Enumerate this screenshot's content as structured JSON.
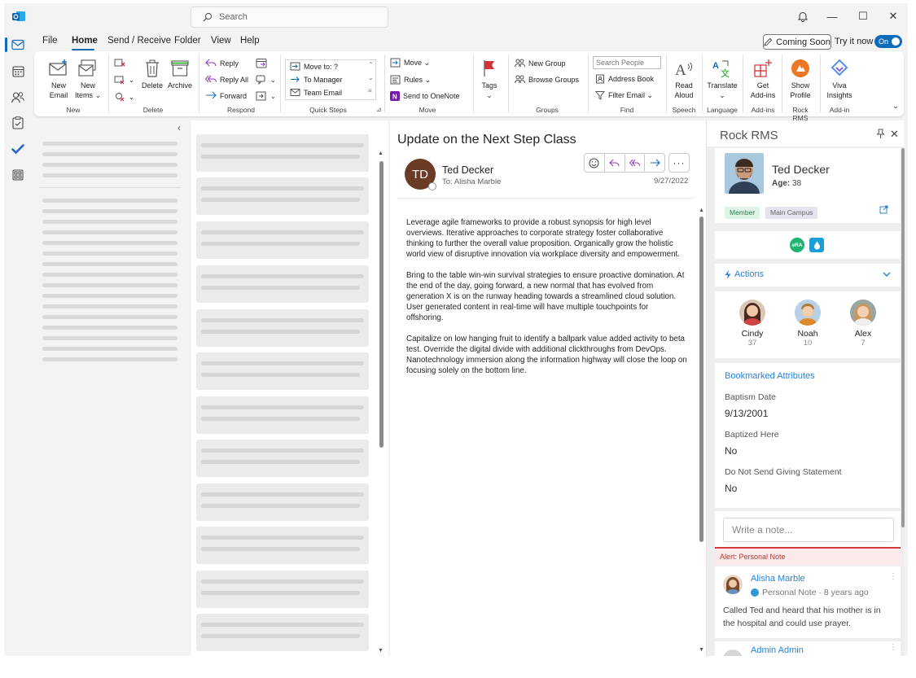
{
  "titlebar": {
    "search_placeholder": "Search",
    "minimize": "—",
    "maximize": "☐",
    "close": "✕"
  },
  "menu": {
    "items": [
      "File",
      "Home",
      "Send / Receive",
      "Folder",
      "View",
      "Help"
    ],
    "active": "Home",
    "coming_soon": "Coming Soon",
    "try_it_now": "Try it now",
    "toggle": "On"
  },
  "ribbon": {
    "new": {
      "new_email_1": "New",
      "new_email_2": "Email",
      "new_items_1": "New",
      "new_items_2": "Items ⌄",
      "label": "New"
    },
    "delete": {
      "delete": "Delete",
      "archive": "Archive",
      "label": "Delete"
    },
    "respond": {
      "reply": "Reply",
      "reply_all": "Reply All",
      "forward": "Forward",
      "label": "Respond"
    },
    "quick_steps": {
      "move_to": "Move to: ?",
      "to_manager": "To Manager",
      "team_email": "Team Email",
      "label": "Quick Steps"
    },
    "move": {
      "move": "Move ⌄",
      "rules": "Rules ⌄",
      "onenote": "Send to OneNote",
      "label": "Move"
    },
    "tags": {
      "tags": "Tags",
      "caret": "⌄"
    },
    "groups": {
      "new_group": "New Group",
      "browse_groups": "Browse Groups",
      "label": "Groups"
    },
    "find": {
      "search_people": "Search People",
      "address_book": "Address Book",
      "filter_email": "Filter Email ⌄",
      "label": "Find"
    },
    "speech": {
      "read_1": "Read",
      "read_2": "Aloud",
      "label": "Speech"
    },
    "language": {
      "translate": "Translate",
      "caret": "⌄",
      "label": "Language"
    },
    "addins": {
      "get_1": "Get",
      "get_2": "Add-ins",
      "label": "Add-ins"
    },
    "rockrms": {
      "show_1": "Show",
      "show_2": "Profile",
      "label": "Rock RMS"
    },
    "viva": {
      "viva_1": "Viva",
      "viva_2": "Insights",
      "label": "Add-in"
    }
  },
  "email": {
    "subject": "Update on the Next Step Class",
    "avatar_initials": "TD",
    "sender": "Ted Decker",
    "to": "To: Alisha Marble",
    "date": "9/27/2022",
    "paragraphs": [
      "Leverage agile frameworks to provide a robust synopsis for high level overviews. Iterative approaches to corporate strategy foster collaborative thinking to further the overall value proposition. Organically grow the holistic world view of disruptive innovation via workplace diversity and empowerment.",
      "Bring to the table win-win survival strategies to ensure proactive domination. At the end of the day, going forward, a new normal that has evolved from generation X is on the runway heading towards a streamlined cloud solution. User generated content in real-time will have multiple touchpoints for offshoring.",
      "Capitalize on low hanging fruit to identify a ballpark value added activity to beta test. Override the digital divide with additional clickthroughs from DevOps. Nanotechnology immersion along the information highway will close the loop on focusing solely on the bottom line."
    ]
  },
  "rock": {
    "title": "Rock RMS",
    "person": {
      "name": "Ted Decker",
      "age_label": "Age:",
      "age": "38"
    },
    "badges": {
      "member": "Member",
      "campus": "Main Campus"
    },
    "era": "eRA",
    "actions": "Actions",
    "family": [
      {
        "name": "Cindy",
        "age": "37"
      },
      {
        "name": "Noah",
        "age": "10"
      },
      {
        "name": "Alex",
        "age": "7"
      }
    ],
    "bookmarked": "Bookmarked Attributes",
    "attributes": [
      {
        "label": "Baptism Date",
        "value": "9/13/2001"
      },
      {
        "label": "Baptized Here",
        "value": "No"
      },
      {
        "label": "Do Not Send Giving Statement",
        "value": "No"
      }
    ],
    "note_placeholder": "Write a note...",
    "alert": "Alert: Personal Note",
    "note": {
      "author": "Alisha Marble",
      "meta": "Personal Note · 8 years ago",
      "text": "Called Ted and heard that his mother is in the hospital and could use prayer."
    },
    "next_author": "Admin Admin"
  },
  "colors": {
    "accent": "#0f6cbd",
    "avatar_bg": "#6b3b26",
    "rock_link": "#2b83d8"
  }
}
